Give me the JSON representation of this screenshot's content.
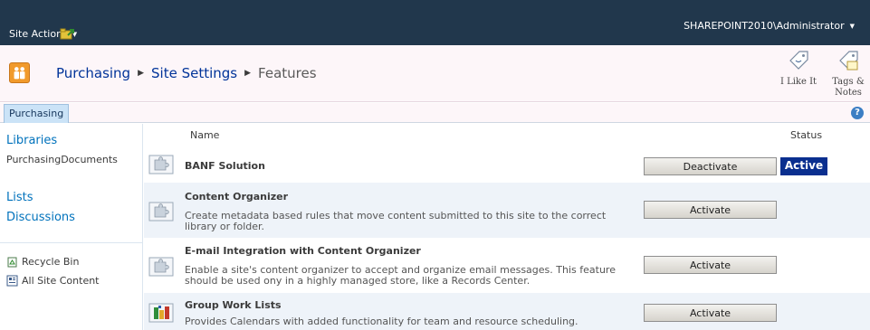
{
  "topbar": {
    "site_actions_label": "Site Actions",
    "user_label": "SHAREPOINT2010\\Administrator",
    "background_color": "#21374c"
  },
  "title_area": {
    "breadcrumb": [
      "Purchasing",
      "Site Settings",
      "Features"
    ],
    "social": {
      "like_label": "I Like It",
      "tags_label_line1": "Tags &",
      "tags_label_line2": "Notes"
    }
  },
  "top_links": {
    "tab_label": "Purchasing",
    "help_glyph": "?"
  },
  "left_nav": {
    "libraries_heading": "Libraries",
    "libraries_items": [
      "PurchasingDocuments"
    ],
    "lists_heading": "Lists",
    "discussions_heading": "Discussions",
    "recycle_bin_label": "Recycle Bin",
    "all_site_content_label": "All Site Content"
  },
  "main": {
    "col_name": "Name",
    "col_status": "Status",
    "features": [
      {
        "title": "BANF Solution",
        "description": "",
        "button": "Deactivate",
        "status": "Active",
        "icon": "puzzle-feature-icon"
      },
      {
        "title": "Content Organizer",
        "description": "Create metadata based rules that move content submitted to this site to the correct library or folder.",
        "button": "Activate",
        "status": "",
        "icon": "puzzle-feature-icon"
      },
      {
        "title": "E-mail Integration with Content Organizer",
        "description": "Enable a site's content organizer to accept and organize email messages. This feature should be used ony in a highly managed store, like a Records Center.",
        "button": "Activate",
        "status": "",
        "icon": "puzzle-feature-icon"
      },
      {
        "title": "Group Work Lists",
        "description": "Provides Calendars with added functionality for team and resource scheduling.",
        "button": "Activate",
        "status": "",
        "icon": "group-work-icon"
      }
    ]
  },
  "colors": {
    "accent_link": "#0072bc",
    "active_badge": "#0a2f8f",
    "alt_row": "#eef3f9"
  }
}
